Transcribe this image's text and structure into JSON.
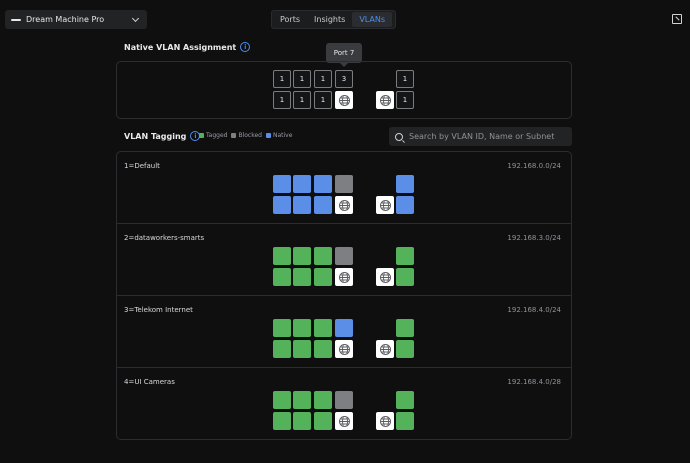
{
  "device": {
    "name": "Dream Machine Pro"
  },
  "tabs": [
    {
      "label": "Ports",
      "active": false
    },
    {
      "label": "Insights",
      "active": false
    },
    {
      "label": "VLANs",
      "active": true
    }
  ],
  "native_section": {
    "title": "Native VLAN Assignment",
    "tooltip": "Port 7"
  },
  "native_ports": {
    "top": [
      "1",
      "1",
      "1",
      "3"
    ],
    "bottom": [
      "1",
      "1",
      "1",
      "globe"
    ],
    "side_top": "1",
    "side_bottom_uplink": "globe",
    "side_bottom": "1"
  },
  "tagging_section": {
    "title": "VLAN Tagging"
  },
  "legend": [
    {
      "label": "Tagged",
      "color": "#54b25a"
    },
    {
      "label": "Blocked",
      "color": "#7d7f83"
    },
    {
      "label": "Native",
      "color": "#5b8ee6"
    }
  ],
  "search": {
    "placeholder": "Search by VLAN ID, Name or Subnet"
  },
  "colors": {
    "tagged": "#54b25a",
    "blocked": "#7d7f83",
    "native": "#5b8ee6",
    "accent": "#4a8ef2"
  },
  "vlans": [
    {
      "name": "1=Default",
      "subnet": "192.168.0.0/24",
      "top": [
        "native",
        "native",
        "native",
        "blocked"
      ],
      "bottom": [
        "native",
        "native",
        "native",
        "uplink"
      ],
      "side_top": "native",
      "side_bottom": "native"
    },
    {
      "name": "2=dataworkers-smarts",
      "subnet": "192.168.3.0/24",
      "top": [
        "tagged",
        "tagged",
        "tagged",
        "blocked"
      ],
      "bottom": [
        "tagged",
        "tagged",
        "tagged",
        "uplink"
      ],
      "side_top": "tagged",
      "side_bottom": "tagged"
    },
    {
      "name": "3=Telekom Internet",
      "subnet": "192.168.4.0/24",
      "top": [
        "tagged",
        "tagged",
        "tagged",
        "native"
      ],
      "bottom": [
        "tagged",
        "tagged",
        "tagged",
        "uplink"
      ],
      "side_top": "tagged",
      "side_bottom": "tagged"
    },
    {
      "name": "4=UI Cameras",
      "subnet": "192.168.4.0/28",
      "top": [
        "tagged",
        "tagged",
        "tagged",
        "blocked"
      ],
      "bottom": [
        "tagged",
        "tagged",
        "tagged",
        "uplink"
      ],
      "side_top": "tagged",
      "side_bottom": "tagged"
    }
  ]
}
